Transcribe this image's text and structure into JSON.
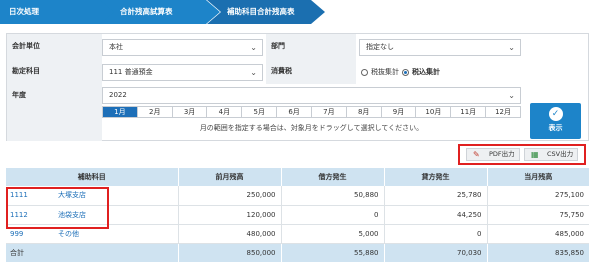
{
  "breadcrumb": [
    "日次処理",
    "合計残高試算表",
    "補助科目合計残高表"
  ],
  "form": {
    "company_unit_label": "会計単位",
    "company_unit_value": "本社",
    "department_label": "部門",
    "department_value": "指定なし",
    "account_label": "勘定科目",
    "account_value": "111 普通預金",
    "tax_label": "消費税",
    "tax_options": [
      "税抜集計",
      "税込集計"
    ],
    "tax_selected": "税込集計",
    "year_label": "年度",
    "year_value": "2022",
    "months": [
      "1月",
      "2月",
      "3月",
      "4月",
      "5月",
      "6月",
      "7月",
      "8月",
      "9月",
      "10月",
      "11月",
      "12月"
    ],
    "active_month": "1月",
    "hint": "月の範囲を指定する場合は、対象月をドラッグして選択してください。",
    "show_label": "表示"
  },
  "export": {
    "pdf_label": "PDF出力",
    "csv_label": "CSV出力"
  },
  "table": {
    "headers": [
      "補助科目",
      "前月残高",
      "借方発生",
      "貸方発生",
      "当月残高"
    ],
    "rows": [
      {
        "code": "1111",
        "name": "大塚支店",
        "prev": "250,000",
        "debit": "50,880",
        "credit": "25,780",
        "current": "275,100"
      },
      {
        "code": "1112",
        "name": "池袋支店",
        "prev": "120,000",
        "debit": "0",
        "credit": "44,250",
        "current": "75,750"
      },
      {
        "code": "999",
        "name": "その他",
        "prev": "480,000",
        "debit": "5,000",
        "credit": "0",
        "current": "485,000"
      }
    ],
    "total": {
      "label": "合計",
      "prev": "850,000",
      "debit": "55,880",
      "credit": "70,030",
      "current": "835,850"
    }
  }
}
